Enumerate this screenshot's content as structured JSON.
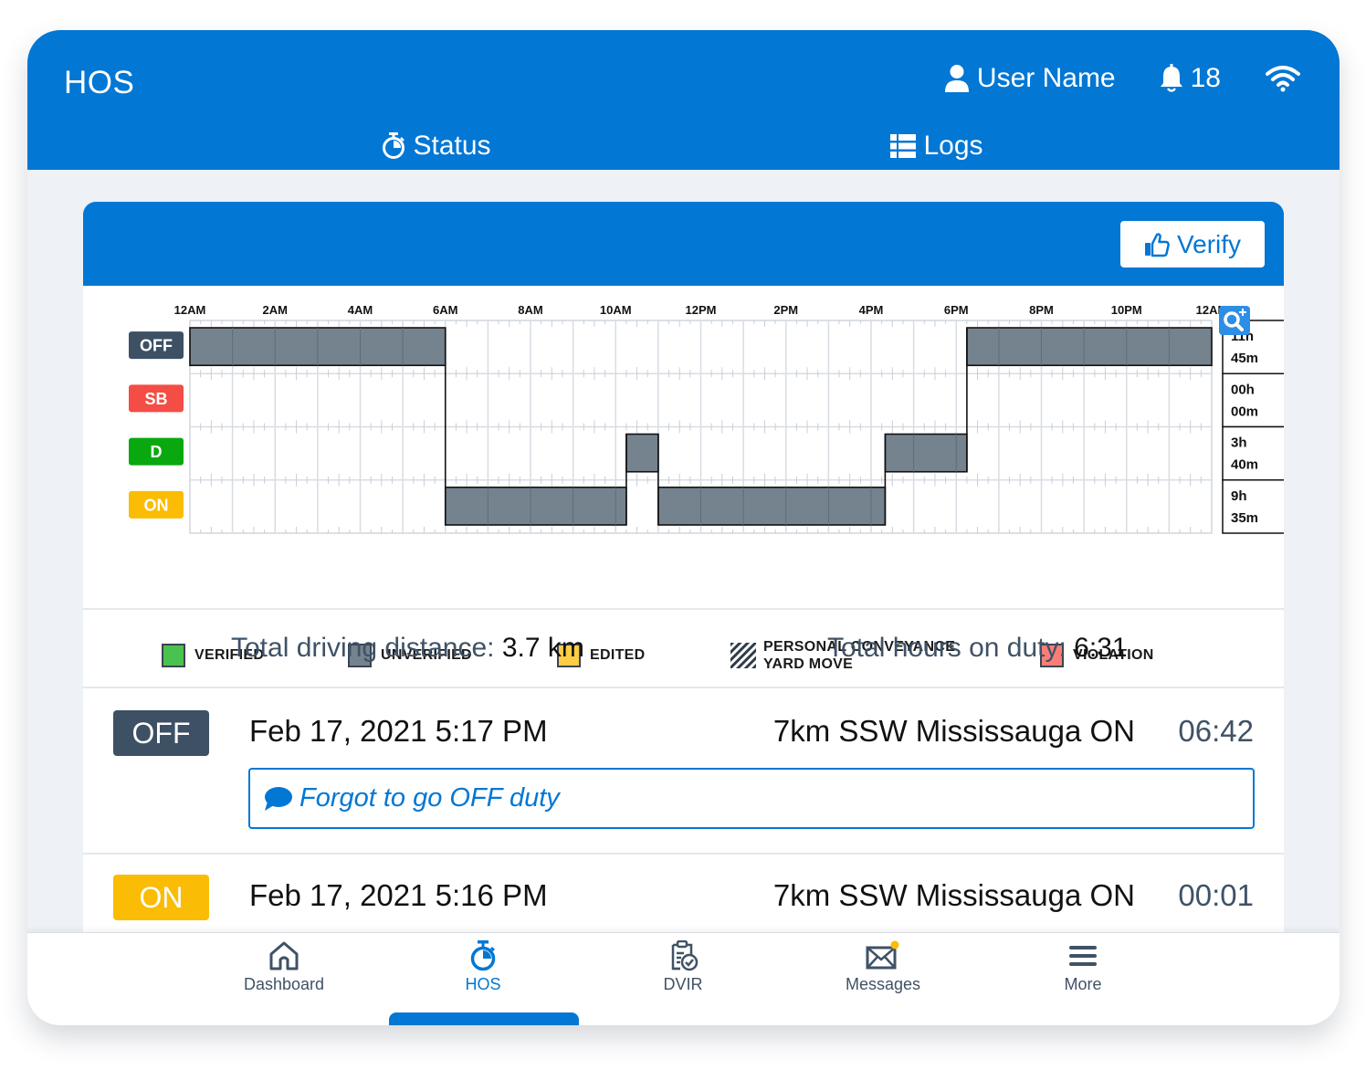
{
  "app": {
    "title": "HOS"
  },
  "header": {
    "user_name": "User Name",
    "notification_count": "18",
    "icons": {
      "user": "user-icon",
      "bell": "bell-icon",
      "wifi": "wifi-icon"
    }
  },
  "tabs": [
    {
      "label": "Status",
      "icon": "stopwatch-icon",
      "active": false
    },
    {
      "label": "Logs",
      "icon": "list-icon",
      "active": true
    }
  ],
  "card": {
    "verify_label": "Verify",
    "verify_icon": "thumbs-up-icon"
  },
  "colors": {
    "brand": "#0277d4",
    "off": "#3d5064",
    "sb": "#f44d45",
    "d": "#09a80e",
    "on": "#fbbc05",
    "segment": "#75838f",
    "verified": "#4cc24e",
    "unverified": "#75838f",
    "edited": "#fecd46",
    "violation": "#fa7e77"
  },
  "chart_data": {
    "type": "step-timeline",
    "title": "",
    "x_unit": "hours",
    "xlim": [
      0,
      24
    ],
    "x_ticks": [
      "12AM",
      "2AM",
      "4AM",
      "6AM",
      "8AM",
      "10AM",
      "12PM",
      "2PM",
      "4PM",
      "6PM",
      "8PM",
      "10PM",
      "12AM"
    ],
    "rows": [
      {
        "key": "OFF",
        "label": "OFF",
        "total": [
          "11h",
          "45m"
        ]
      },
      {
        "key": "SB",
        "label": "SB",
        "total": [
          "00h",
          "00m"
        ]
      },
      {
        "key": "D",
        "label": "D",
        "total": [
          "3h",
          "40m"
        ]
      },
      {
        "key": "ON",
        "label": "ON",
        "total": [
          "9h",
          "35m"
        ]
      }
    ],
    "segments": [
      {
        "status": "OFF",
        "start": 0.0,
        "end": 6.0,
        "state": "unverified"
      },
      {
        "status": "ON",
        "start": 6.0,
        "end": 10.25,
        "state": "unverified"
      },
      {
        "status": "D",
        "start": 10.25,
        "end": 11.0,
        "state": "unverified"
      },
      {
        "status": "ON",
        "start": 11.0,
        "end": 16.33,
        "state": "unverified"
      },
      {
        "status": "D",
        "start": 16.33,
        "end": 18.25,
        "state": "unverified"
      },
      {
        "status": "OFF",
        "start": 18.25,
        "end": 24.0,
        "state": "unverified"
      }
    ],
    "zoom_icon": "zoom-in-icon",
    "legend": [
      {
        "label": "VERIFIED",
        "swatch": "verified"
      },
      {
        "label": "UNVERIFIED",
        "swatch": "unverified"
      },
      {
        "label": "EDITED",
        "swatch": "edited"
      },
      {
        "label": "PERSONAL CONVEYANCE",
        "label2": "YARD MOVE",
        "swatch": "hatched"
      },
      {
        "label": "VIOLATION",
        "swatch": "violation"
      }
    ]
  },
  "totals": {
    "distance_label": "Total driving distance:",
    "distance_value": "3.7 km",
    "duty_label": "Total hours on duty:",
    "duty_value": "6:31"
  },
  "logs": [
    {
      "status": "OFF",
      "datetime": "Feb 17, 2021 5:17 PM",
      "location": "7km SSW Mississauga ON",
      "duration": "06:42",
      "annotation": "Forgot to go OFF duty"
    },
    {
      "status": "ON",
      "datetime": "Feb 17, 2021 5:16 PM",
      "location": "7km SSW Mississauga ON",
      "duration": "00:01"
    }
  ],
  "bottom_nav": [
    {
      "label": "Dashboard",
      "icon": "home-icon",
      "active": false
    },
    {
      "label": "HOS",
      "icon": "stopwatch-icon",
      "active": true
    },
    {
      "label": "DVIR",
      "icon": "clipboard-check-icon",
      "active": false
    },
    {
      "label": "Messages",
      "icon": "envelope-icon",
      "active": false,
      "has_badge": true
    },
    {
      "label": "More",
      "icon": "menu-icon",
      "active": false
    }
  ]
}
